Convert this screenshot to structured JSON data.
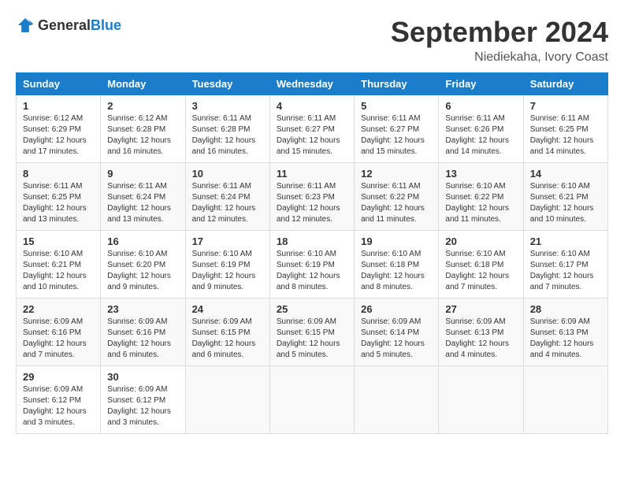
{
  "header": {
    "logo_general": "General",
    "logo_blue": "Blue",
    "month_title": "September 2024",
    "subtitle": "Niediekaha, Ivory Coast"
  },
  "columns": [
    "Sunday",
    "Monday",
    "Tuesday",
    "Wednesday",
    "Thursday",
    "Friday",
    "Saturday"
  ],
  "weeks": [
    [
      {
        "day": "1",
        "info": "Sunrise: 6:12 AM\nSunset: 6:29 PM\nDaylight: 12 hours\nand 17 minutes."
      },
      {
        "day": "2",
        "info": "Sunrise: 6:12 AM\nSunset: 6:28 PM\nDaylight: 12 hours\nand 16 minutes."
      },
      {
        "day": "3",
        "info": "Sunrise: 6:11 AM\nSunset: 6:28 PM\nDaylight: 12 hours\nand 16 minutes."
      },
      {
        "day": "4",
        "info": "Sunrise: 6:11 AM\nSunset: 6:27 PM\nDaylight: 12 hours\nand 15 minutes."
      },
      {
        "day": "5",
        "info": "Sunrise: 6:11 AM\nSunset: 6:27 PM\nDaylight: 12 hours\nand 15 minutes."
      },
      {
        "day": "6",
        "info": "Sunrise: 6:11 AM\nSunset: 6:26 PM\nDaylight: 12 hours\nand 14 minutes."
      },
      {
        "day": "7",
        "info": "Sunrise: 6:11 AM\nSunset: 6:25 PM\nDaylight: 12 hours\nand 14 minutes."
      }
    ],
    [
      {
        "day": "8",
        "info": "Sunrise: 6:11 AM\nSunset: 6:25 PM\nDaylight: 12 hours\nand 13 minutes."
      },
      {
        "day": "9",
        "info": "Sunrise: 6:11 AM\nSunset: 6:24 PM\nDaylight: 12 hours\nand 13 minutes."
      },
      {
        "day": "10",
        "info": "Sunrise: 6:11 AM\nSunset: 6:24 PM\nDaylight: 12 hours\nand 12 minutes."
      },
      {
        "day": "11",
        "info": "Sunrise: 6:11 AM\nSunset: 6:23 PM\nDaylight: 12 hours\nand 12 minutes."
      },
      {
        "day": "12",
        "info": "Sunrise: 6:11 AM\nSunset: 6:22 PM\nDaylight: 12 hours\nand 11 minutes."
      },
      {
        "day": "13",
        "info": "Sunrise: 6:10 AM\nSunset: 6:22 PM\nDaylight: 12 hours\nand 11 minutes."
      },
      {
        "day": "14",
        "info": "Sunrise: 6:10 AM\nSunset: 6:21 PM\nDaylight: 12 hours\nand 10 minutes."
      }
    ],
    [
      {
        "day": "15",
        "info": "Sunrise: 6:10 AM\nSunset: 6:21 PM\nDaylight: 12 hours\nand 10 minutes."
      },
      {
        "day": "16",
        "info": "Sunrise: 6:10 AM\nSunset: 6:20 PM\nDaylight: 12 hours\nand 9 minutes."
      },
      {
        "day": "17",
        "info": "Sunrise: 6:10 AM\nSunset: 6:19 PM\nDaylight: 12 hours\nand 9 minutes."
      },
      {
        "day": "18",
        "info": "Sunrise: 6:10 AM\nSunset: 6:19 PM\nDaylight: 12 hours\nand 8 minutes."
      },
      {
        "day": "19",
        "info": "Sunrise: 6:10 AM\nSunset: 6:18 PM\nDaylight: 12 hours\nand 8 minutes."
      },
      {
        "day": "20",
        "info": "Sunrise: 6:10 AM\nSunset: 6:18 PM\nDaylight: 12 hours\nand 7 minutes."
      },
      {
        "day": "21",
        "info": "Sunrise: 6:10 AM\nSunset: 6:17 PM\nDaylight: 12 hours\nand 7 minutes."
      }
    ],
    [
      {
        "day": "22",
        "info": "Sunrise: 6:09 AM\nSunset: 6:16 PM\nDaylight: 12 hours\nand 7 minutes."
      },
      {
        "day": "23",
        "info": "Sunrise: 6:09 AM\nSunset: 6:16 PM\nDaylight: 12 hours\nand 6 minutes."
      },
      {
        "day": "24",
        "info": "Sunrise: 6:09 AM\nSunset: 6:15 PM\nDaylight: 12 hours\nand 6 minutes."
      },
      {
        "day": "25",
        "info": "Sunrise: 6:09 AM\nSunset: 6:15 PM\nDaylight: 12 hours\nand 5 minutes."
      },
      {
        "day": "26",
        "info": "Sunrise: 6:09 AM\nSunset: 6:14 PM\nDaylight: 12 hours\nand 5 minutes."
      },
      {
        "day": "27",
        "info": "Sunrise: 6:09 AM\nSunset: 6:13 PM\nDaylight: 12 hours\nand 4 minutes."
      },
      {
        "day": "28",
        "info": "Sunrise: 6:09 AM\nSunset: 6:13 PM\nDaylight: 12 hours\nand 4 minutes."
      }
    ],
    [
      {
        "day": "29",
        "info": "Sunrise: 6:09 AM\nSunset: 6:12 PM\nDaylight: 12 hours\nand 3 minutes."
      },
      {
        "day": "30",
        "info": "Sunrise: 6:09 AM\nSunset: 6:12 PM\nDaylight: 12 hours\nand 3 minutes."
      },
      {
        "day": "",
        "info": ""
      },
      {
        "day": "",
        "info": ""
      },
      {
        "day": "",
        "info": ""
      },
      {
        "day": "",
        "info": ""
      },
      {
        "day": "",
        "info": ""
      }
    ]
  ]
}
